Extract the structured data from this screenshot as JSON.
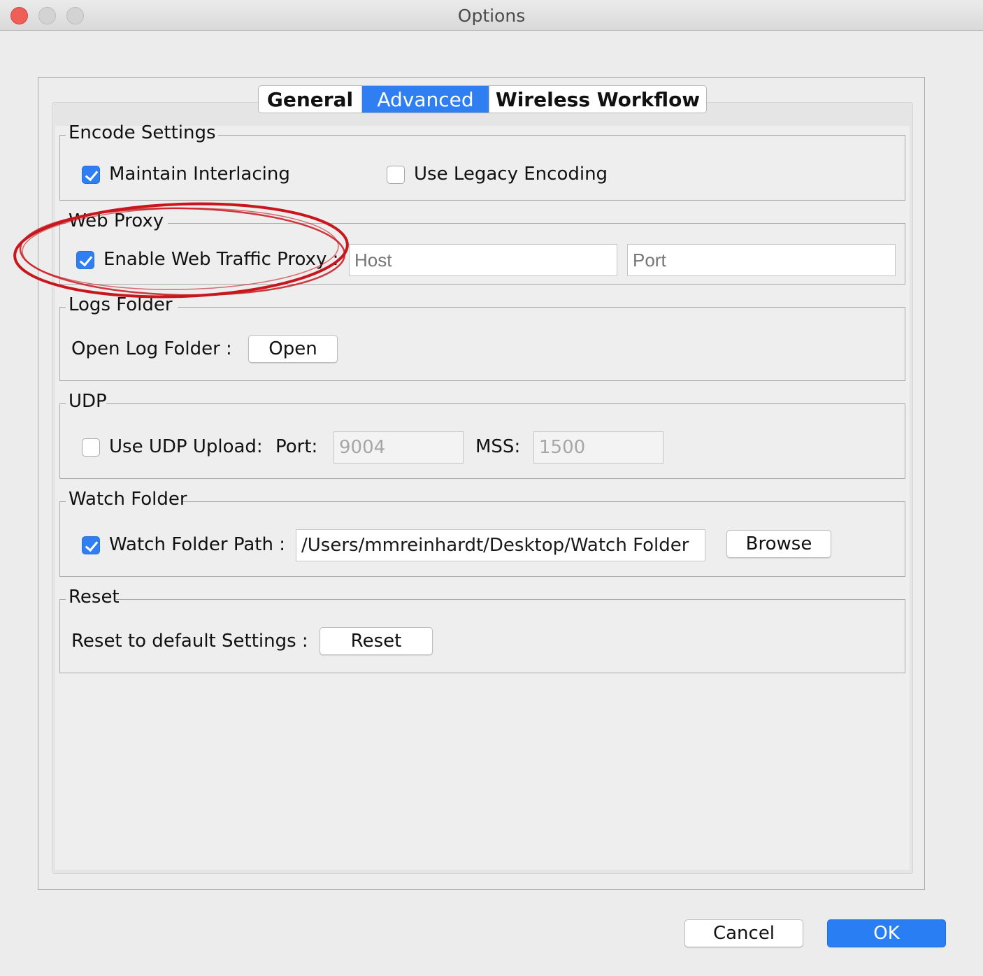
{
  "window": {
    "title": "Options"
  },
  "tabs": [
    {
      "label": "General",
      "active": false
    },
    {
      "label": "Advanced",
      "active": true
    },
    {
      "label": "Wireless Workflow",
      "active": false
    }
  ],
  "encode_settings": {
    "legend": "Encode Settings",
    "maintain_interlacing": {
      "label": "Maintain Interlacing",
      "checked": true
    },
    "use_legacy_encoding": {
      "label": "Use Legacy Encoding",
      "checked": false
    }
  },
  "web_proxy": {
    "legend": "Web Proxy",
    "enable_proxy": {
      "label": "Enable Web Traffic Proxy :",
      "checked": true
    },
    "host_placeholder": "Host",
    "port_placeholder": "Port"
  },
  "logs_folder": {
    "legend": "Logs Folder",
    "label": "Open Log Folder :",
    "button": "Open"
  },
  "udp": {
    "legend": "UDP",
    "use_udp_upload": {
      "label": "Use UDP Upload:",
      "checked": false
    },
    "port_label": "Port:",
    "port_value": "9004",
    "mss_label": "MSS:",
    "mss_value": "1500"
  },
  "watch_folder": {
    "legend": "Watch Folder",
    "watch_folder_path": {
      "label": "Watch Folder Path :",
      "checked": true
    },
    "path_value": "/Users/mmreinhardt/Desktop/Watch Folder",
    "button": "Browse"
  },
  "reset": {
    "legend": "Reset",
    "label": "Reset to default Settings :",
    "button": "Reset"
  },
  "footer": {
    "cancel": "Cancel",
    "ok": "OK"
  },
  "colors": {
    "accent": "#2f7ef2",
    "annotation": "#c8161d"
  }
}
